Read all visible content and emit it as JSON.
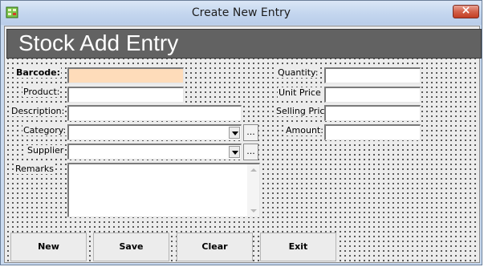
{
  "window": {
    "title": "Create New Entry",
    "close_label": "×"
  },
  "header": {
    "title": "Stock Add Entry"
  },
  "form": {
    "barcode_label": "Barcode:",
    "product_label": "Product:",
    "description_label": "Description:",
    "category_label": "Category:",
    "supplier_label": "Supplier",
    "remarks_label": "Remarks",
    "quantity_label": "Quantity:",
    "unit_price_label": "Unit Price",
    "selling_price_label": "Selling Price",
    "amount_label": "Amount:",
    "ellipsis": "...",
    "barcode_value": "",
    "product_value": "",
    "description_value": "",
    "category_value": "",
    "supplier_value": "",
    "remarks_value": "",
    "quantity_value": "",
    "unit_price_value": "",
    "selling_price_value": "",
    "amount_value": ""
  },
  "buttons": {
    "new": "New",
    "save": "Save",
    "clear": "Clear",
    "exit": "Exit"
  },
  "colors": {
    "barcode_bg": "#fedcba",
    "header_bg": "#626262"
  }
}
